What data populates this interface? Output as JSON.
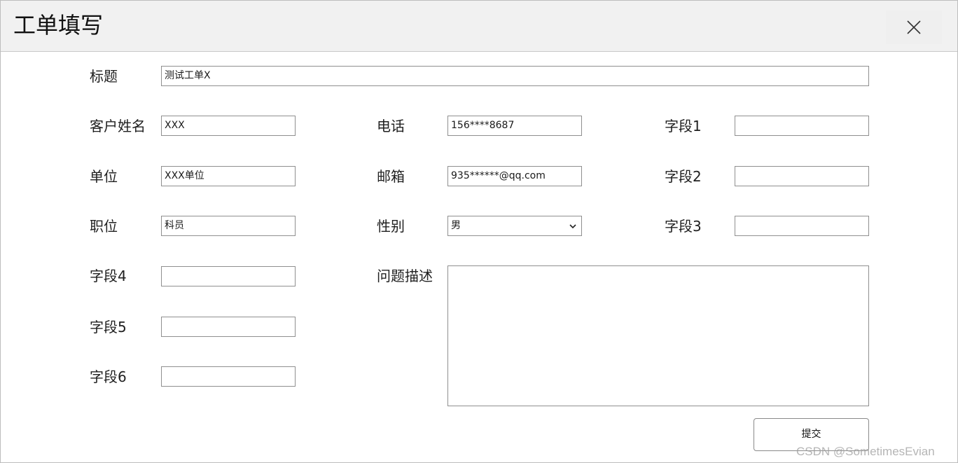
{
  "dialog": {
    "title": "工单填写",
    "close_icon": "close-icon"
  },
  "form": {
    "title_label": "标题",
    "title_value": "测试工单X",
    "customer_name_label": "客户姓名",
    "customer_name_value": "XXX",
    "phone_label": "电话",
    "phone_value": "156****8687",
    "field1_label": "字段1",
    "field1_value": "",
    "unit_label": "单位",
    "unit_value": "XXX单位",
    "email_label": "邮箱",
    "email_value": "935******@qq.com",
    "field2_label": "字段2",
    "field2_value": "",
    "position_label": "职位",
    "position_value": "科员",
    "gender_label": "性别",
    "gender_value": "男",
    "field3_label": "字段3",
    "field3_value": "",
    "field4_label": "字段4",
    "field4_value": "",
    "field5_label": "字段5",
    "field5_value": "",
    "field6_label": "字段6",
    "field6_value": "",
    "description_label": "问题描述",
    "description_value": ""
  },
  "actions": {
    "submit_label": "提交"
  },
  "watermark": {
    "text": "CSDN @SometimesEvian"
  }
}
